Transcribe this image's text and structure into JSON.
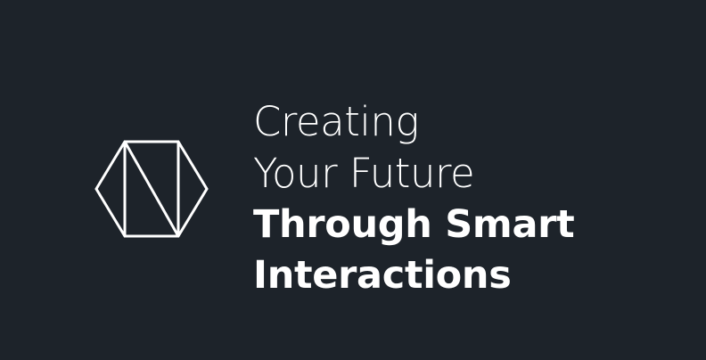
{
  "colors": {
    "background": "#1d232a",
    "text": "#ffffff",
    "logo_stroke": "#ffffff"
  },
  "logo": {
    "icon": "hexagon-n-logo-icon"
  },
  "headline": {
    "line1": "Creating",
    "line2": "Your Future",
    "line3": "Through Smart",
    "line4": "Interactions"
  }
}
